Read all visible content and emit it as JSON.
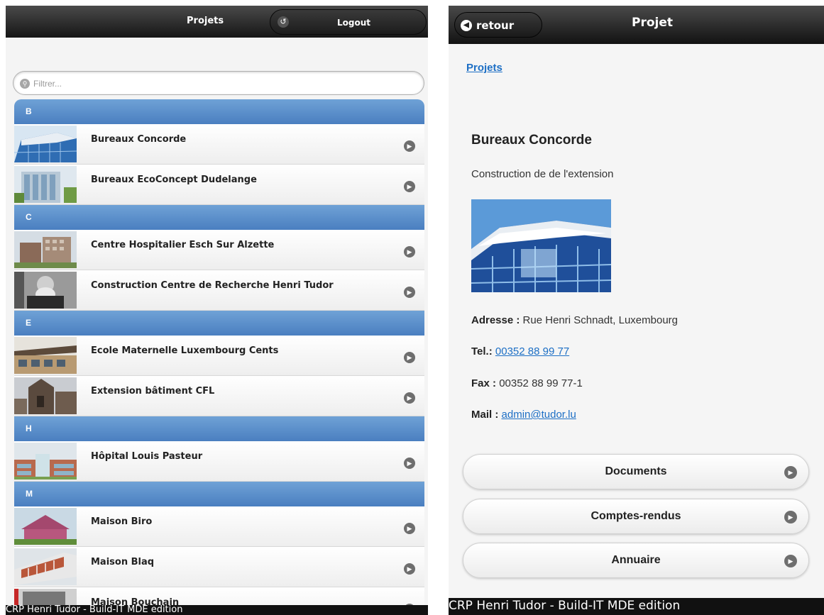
{
  "left": {
    "header": {
      "title": "Projets",
      "logout_label": "Logout"
    },
    "filter": {
      "placeholder": "Filtrer..."
    },
    "groups": [
      {
        "letter": "B",
        "items": [
          "Bureaux Concorde",
          "Bureaux EcoConcept Dudelange"
        ]
      },
      {
        "letter": "C",
        "items": [
          "Centre Hospitalier Esch Sur Alzette",
          "Construction Centre de Recherche Henri Tudor"
        ]
      },
      {
        "letter": "E",
        "items": [
          "Ecole Maternelle Luxembourg Cents",
          "Extension bâtiment CFL"
        ]
      },
      {
        "letter": "H",
        "items": [
          "Hôpital Louis Pasteur"
        ]
      },
      {
        "letter": "M",
        "items": [
          "Maison Biro",
          "Maison Blaq",
          "Maison Bouchain"
        ]
      }
    ],
    "footer": "CRP Henri Tudor - Build-IT MDE edition"
  },
  "right": {
    "header": {
      "back_label": "retour",
      "title": "Projet"
    },
    "breadcrumb": "Projets",
    "project": {
      "name": "Bureaux Concorde",
      "description": "Construction de de l'extension",
      "address_label": "Adresse :",
      "address": "Rue Henri Schnadt, Luxembourg",
      "tel_label": "Tel.:",
      "tel": "00352 88 99 77",
      "fax_label": "Fax :",
      "fax": "00352 88 99 77-1",
      "mail_label": "Mail :",
      "mail": "admin@tudor.lu"
    },
    "buttons": [
      "Documents",
      "Comptes-rendus",
      "Annuaire"
    ],
    "footer": "CRP Henri Tudor - Build-IT MDE edition"
  }
}
